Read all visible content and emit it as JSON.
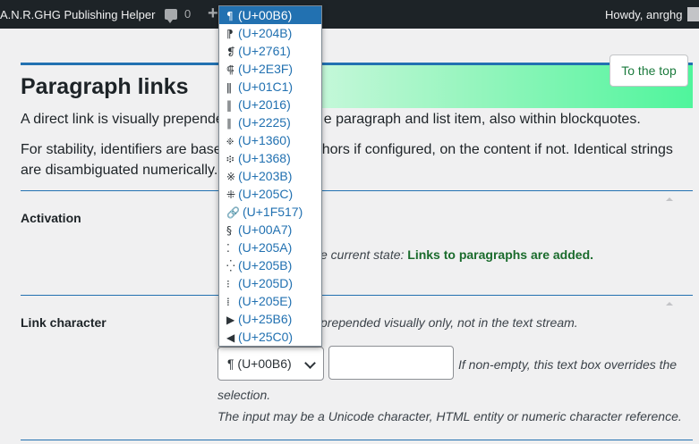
{
  "adminbar": {
    "site_name": "A.N.R.GHG Publishing Helper",
    "comments_count": "0",
    "new_icon": "+",
    "howdy": "Howdy, anrghg"
  },
  "page": {
    "to_top_label": "To the top",
    "title": "Paragraph links",
    "intro_1_before": "A direct link is visually prepende",
    "intro_1_after": "e paragraph and list item, also within blockquotes.",
    "intro_2_line1_before": "For stability, identifiers are base",
    "intro_2_line1_after": "hors if configured, on the content if not. Identical strings",
    "intro_2_line2": "are disambiguated numerically."
  },
  "activation": {
    "label": "Activation",
    "state_prefix": "e current state: ",
    "state_value": "Links to paragraphs are added."
  },
  "link_character": {
    "label": "Link character",
    "prepended_note": "prepended visually only, not in the text stream.",
    "selected_value": "¶ (U+00B6)",
    "override_note": "If non-empty, this text box overrides the",
    "override_note_2": "selection.",
    "input_hint": "The input may be a Unicode character, HTML entity or numeric character reference."
  },
  "dropdown": {
    "options": [
      {
        "glyph": "¶",
        "code": "(U+00B6)",
        "selected": true
      },
      {
        "glyph": "⁋",
        "code": "(U+204B)"
      },
      {
        "glyph": "❡",
        "code": "(U+2761)"
      },
      {
        "glyph": "⸿",
        "code": "(U+2E3F)"
      },
      {
        "glyph": "ǁ",
        "code": "(U+01C1)"
      },
      {
        "glyph": "‖",
        "code": "(U+2016)"
      },
      {
        "glyph": "∥",
        "code": "(U+2225)"
      },
      {
        "glyph": "፠",
        "code": "(U+1360)"
      },
      {
        "glyph": "፨",
        "code": "(U+1368)"
      },
      {
        "glyph": "※",
        "code": "(U+203B)"
      },
      {
        "glyph": "⁜",
        "code": "(U+205C)"
      },
      {
        "glyph": "🔗",
        "code": "(U+1F517)"
      },
      {
        "glyph": "§",
        "code": "(U+00A7)"
      },
      {
        "glyph": "⁚",
        "code": "(U+205A)"
      },
      {
        "glyph": "⁛",
        "code": "(U+205B)"
      },
      {
        "glyph": "⁝",
        "code": "(U+205D)"
      },
      {
        "glyph": "⁞",
        "code": "(U+205E)"
      },
      {
        "glyph": "▶",
        "code": "(U+25B6)"
      },
      {
        "glyph": "◀",
        "code": "(U+25C0)"
      }
    ]
  }
}
